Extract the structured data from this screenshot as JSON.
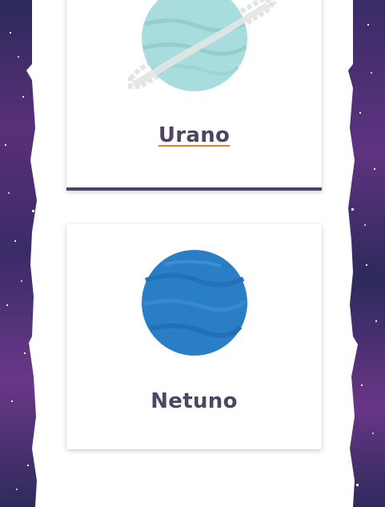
{
  "cards": [
    {
      "title": "Urano",
      "planet_icon": "uranus-pixel-icon",
      "linked": true
    },
    {
      "title": "Netuno",
      "planet_icon": "neptune-pixel-icon",
      "linked": false
    }
  ],
  "colors": {
    "title_text": "#4f4563",
    "link_underline": "#e57c2b",
    "card_border": "#4d4268",
    "galaxy_base": "#2f2a5e",
    "galaxy_accent": "#6b3a8c",
    "uranus": "#a9dcdc",
    "neptune": "#2a7ec6"
  }
}
